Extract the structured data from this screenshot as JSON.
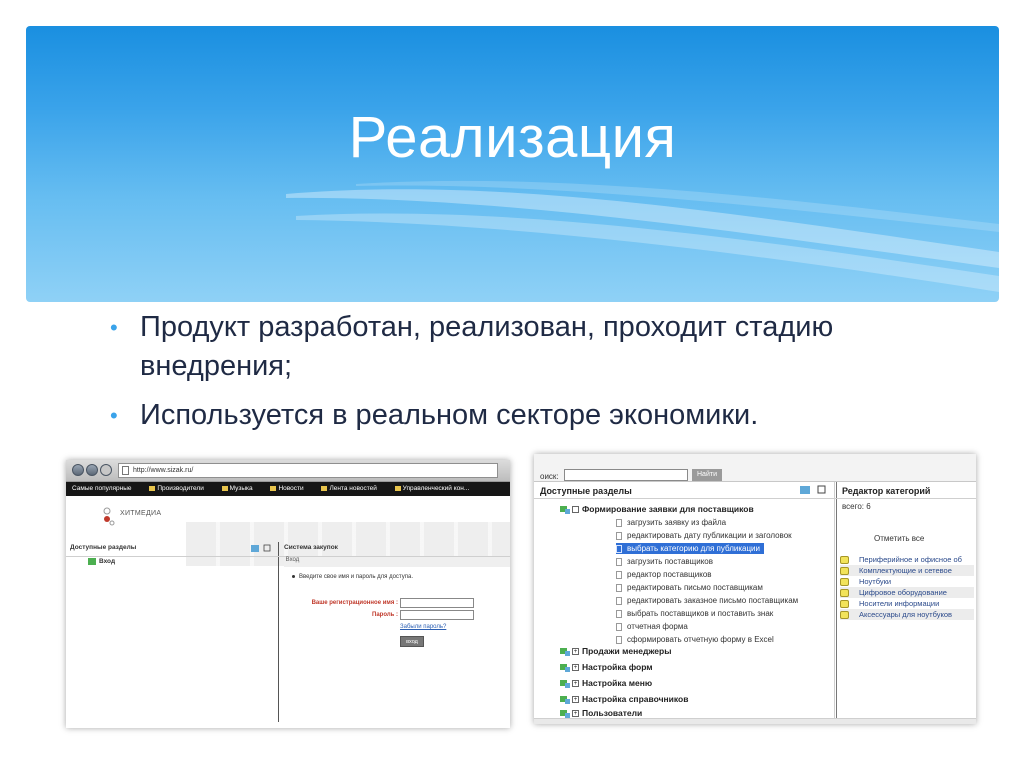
{
  "slide": {
    "title": "Реализация",
    "bullets": [
      "Продукт разработан, реализован, проходит стадию внедрения;",
      "Используется в реальном секторе экономики."
    ],
    "accent_color": "#3aa3ea"
  },
  "shot_left": {
    "url": "http://www.sizak.ru/",
    "bookmarks": [
      "Самые популярные",
      "Производители",
      "Музыка",
      "Новости",
      "Лента новостей",
      "Управленческий кон..."
    ],
    "logo_text": "ХИТМЕДИА",
    "left_header": "Доступные разделы",
    "right_header": "Система закупок",
    "tree_item": "Вход",
    "login_tab": "Вход",
    "message": "Введите свое имя и пароль для доступа.",
    "username_label": "Ваше регистрационное имя :",
    "password_label": "Пароль :",
    "forgot_link": "Забыли пароль?",
    "submit_button": "вход"
  },
  "shot_right": {
    "search_label": "оиск:",
    "search_button": "Найти",
    "left_header": "Доступные разделы",
    "right_header": "Редактор категорий",
    "count_label": "всего: 6",
    "select_all": "Отметить все",
    "groups": [
      {
        "label": "Формирование заявки для поставщиков",
        "expanded": true
      },
      {
        "label": "Продажи менеджеры",
        "expanded": false
      },
      {
        "label": "Настройка форм",
        "expanded": false
      },
      {
        "label": "Настройка меню",
        "expanded": false
      },
      {
        "label": "Настройка справочников",
        "expanded": false
      },
      {
        "label": "Пользователи",
        "expanded": false
      }
    ],
    "items": [
      "загрузить заявку из файла",
      "редактировать дату публикации и заголовок",
      "выбрать категорию для публикации",
      "загрузить поставщиков",
      "редактор поставщиков",
      "редактировать письмо поставщикам",
      "редактировать заказное письмо поставщикам",
      "выбрать поставщиков и поставить знак",
      "отчетная форма",
      "сформировать отчетную форму в Excel"
    ],
    "selected_item_index": 2,
    "categories": [
      "Периферийное и офисное об",
      "Комплектующие и сетевое",
      "Ноутбуки",
      "Цифровое оборудование",
      "Носители информации",
      "Аксессуары для ноутбуков"
    ]
  }
}
